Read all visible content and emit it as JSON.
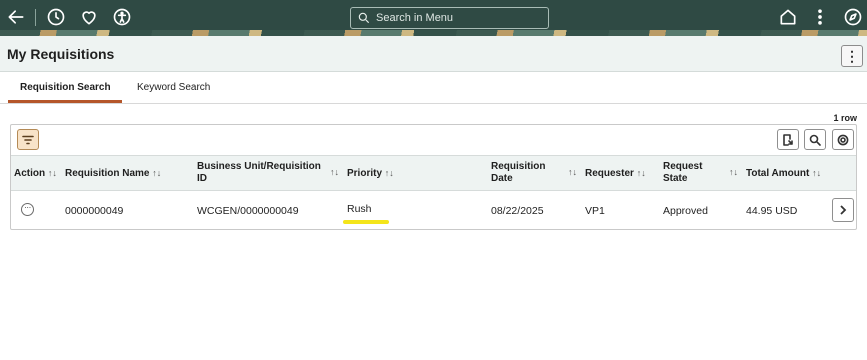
{
  "topbar": {
    "icons": [
      "back-arrow-icon",
      "recent-history-icon",
      "favorites-heart-icon",
      "accessibility-icon",
      "home-icon",
      "more-actions-kebab-icon",
      "navigator-compass-icon"
    ],
    "search_placeholder": "Search in Menu"
  },
  "header": {
    "title": "My Requisitions"
  },
  "tabs": [
    {
      "label": "Requisition Search",
      "active": true
    },
    {
      "label": "Keyword Search",
      "active": false
    }
  ],
  "grid": {
    "row_count": "1 row",
    "sort_glyph": "↑↓",
    "columns": {
      "action": "Action",
      "name": "Requisition Name",
      "bu_line1": "Business Unit/Requisition",
      "bu_line2": "ID",
      "priority": "Priority",
      "date_line1": "Requisition",
      "date_line2": "Date",
      "requester": "Requester",
      "state_line1": "Request",
      "state_line2": "State",
      "total": "Total Amount"
    },
    "rows": [
      {
        "name": "0000000049",
        "bu_id": "WCGEN/0000000049",
        "priority": "Rush",
        "date": "08/22/2025",
        "requester": "VP1",
        "state": "Approved",
        "total": "44.95 USD"
      }
    ]
  },
  "colors": {
    "topbar_bg": "#2f4a44",
    "tab_accent": "#b5562a",
    "highlight": "#f4e51a"
  }
}
